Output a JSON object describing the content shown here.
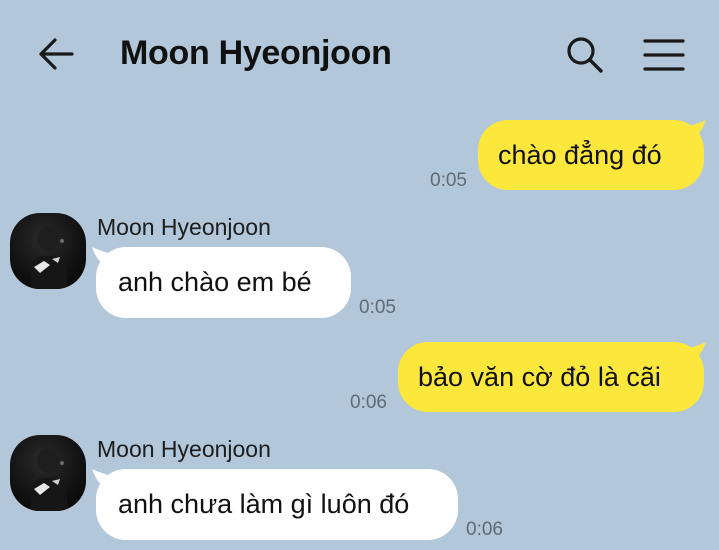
{
  "header": {
    "title": "Moon Hyeonjoon",
    "back_icon": "arrow-left-icon",
    "search_icon": "search-icon",
    "menu_icon": "hamburger-menu-icon"
  },
  "colors": {
    "background": "#b2c7da",
    "outgoing_bubble": "#fce73c",
    "incoming_bubble": "#ffffff",
    "timestamp": "#5f6b76"
  },
  "messages": [
    {
      "direction": "outgoing",
      "text": "chào đẳng đó",
      "time": "0:05"
    },
    {
      "direction": "incoming",
      "sender": "Moon Hyeonjoon",
      "text": "anh chào em bé",
      "time": "0:05"
    },
    {
      "direction": "outgoing",
      "text": "bảo văn cờ đỏ là cãi",
      "time": "0:06"
    },
    {
      "direction": "incoming",
      "sender": "Moon Hyeonjoon",
      "text": "anh chưa làm gì luôn đó",
      "time": "0:06"
    }
  ]
}
